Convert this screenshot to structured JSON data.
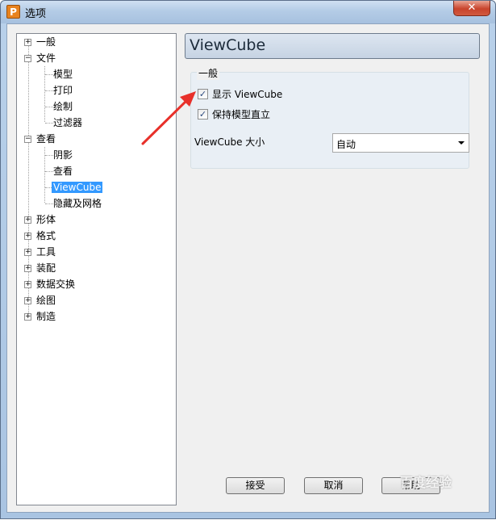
{
  "window": {
    "title": "选项",
    "app_icon": "P",
    "close_symbol": "✕"
  },
  "tree": {
    "items": [
      {
        "label": "一般",
        "expander": "+"
      },
      {
        "label": "文件",
        "expander": "−",
        "children": [
          "模型",
          "打印",
          "绘制",
          "过滤器"
        ]
      },
      {
        "label": "查看",
        "expander": "−",
        "children": [
          "阴影",
          "查看",
          "ViewCube",
          "隐藏及网格"
        ]
      },
      {
        "label": "形体",
        "expander": "+"
      },
      {
        "label": "格式",
        "expander": "+"
      },
      {
        "label": "工具",
        "expander": "+"
      },
      {
        "label": "装配",
        "expander": "+"
      },
      {
        "label": "数据交换",
        "expander": "+"
      },
      {
        "label": "绘图",
        "expander": "+"
      },
      {
        "label": "制造",
        "expander": "+"
      }
    ],
    "selected": "ViewCube"
  },
  "panel": {
    "header": "ViewCube",
    "group_title": "一般",
    "show_viewcube": {
      "label": "显示 ViewCube",
      "checked": true
    },
    "keep_upright": {
      "label": "保持模型直立",
      "checked": true
    },
    "size_label": "ViewCube 大小",
    "size_value": "自动"
  },
  "buttons": {
    "ok": "接受",
    "cancel": "取消",
    "help": "帮助"
  },
  "watermark": "百度经验",
  "colors": {
    "selection": "#3399ff",
    "annotation_arrow": "#e8302a",
    "close_button": "#c8442c"
  }
}
